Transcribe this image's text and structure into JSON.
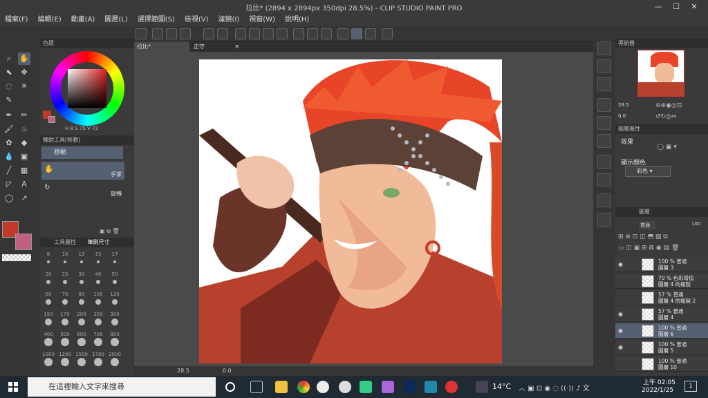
{
  "window": {
    "title": "拉比* (2894 x 2894px 350dpi 28.5%) - CLIP STUDIO PAINT PRO"
  },
  "menu": [
    "檔案(F)",
    "編輯(E)",
    "動畫(A)",
    "圖層(L)",
    "選擇範圍(S)",
    "檢視(V)",
    "濾鏡(I)",
    "視窗(W)",
    "說明(H)"
  ],
  "color_panel": {
    "title": "色環",
    "h": "H",
    "s": "S",
    "v": "V",
    "s_value": "75",
    "v_value": "72",
    "h_value": "8"
  },
  "subtool": {
    "title": "輔助工具[移動]",
    "group": "移動",
    "item1": "手掌",
    "item2": "旋轉"
  },
  "brush": {
    "tab1": "工具屬性",
    "tab2": "筆刷尺寸",
    "sizes": [
      "8",
      "10",
      "12",
      "15",
      "17",
      "20",
      "25",
      "30",
      "40",
      "50",
      "60",
      "70",
      "80",
      "100",
      "120",
      "150",
      "170",
      "200",
      "250",
      "300",
      "400",
      "500",
      "600",
      "700",
      "800",
      "1000",
      "1200",
      "1500",
      "1700",
      "2000"
    ]
  },
  "canvas": {
    "tab1": "拉比*",
    "tab2": "正守"
  },
  "status": {
    "zoom": "28.5",
    "angle": "0.0"
  },
  "navigator": {
    "title": "導航器",
    "zoom": "28.5",
    "angle": "0.0"
  },
  "properties": {
    "title": "圖層屬性",
    "effect": "效果",
    "display_color": "顯示顏色",
    "color_mode": "彩色"
  },
  "layers": {
    "title": "圖層",
    "blend": "普通",
    "opacity": "100",
    "items": [
      {
        "l1": "100 % 普通",
        "l2": "圖層 3",
        "visible": true,
        "sel": false
      },
      {
        "l1": "70 % 色彩增值",
        "l2": "圖層 4 的複製",
        "visible": false,
        "sel": false
      },
      {
        "l1": "57 % 普通",
        "l2": "圖層 4 的複製 2",
        "visible": false,
        "sel": false
      },
      {
        "l1": "57 % 普通",
        "l2": "圖層 4",
        "visible": true,
        "sel": false
      },
      {
        "l1": "100 % 普通",
        "l2": "圖層 6",
        "visible": true,
        "sel": true
      },
      {
        "l1": "100 % 普通",
        "l2": "圖層 5",
        "visible": true,
        "sel": false
      },
      {
        "l1": "100 % 普通",
        "l2": "圖層 10",
        "visible": false,
        "sel": false
      }
    ]
  },
  "taskbar": {
    "search_placeholder": "在這裡輸入文字來搜尋",
    "weather": "14°C",
    "time": "上午 02:05",
    "date": "2022/1/25"
  },
  "colors": {
    "main": "#c0392b",
    "sub": "#c06080",
    "accent": "#556173"
  }
}
